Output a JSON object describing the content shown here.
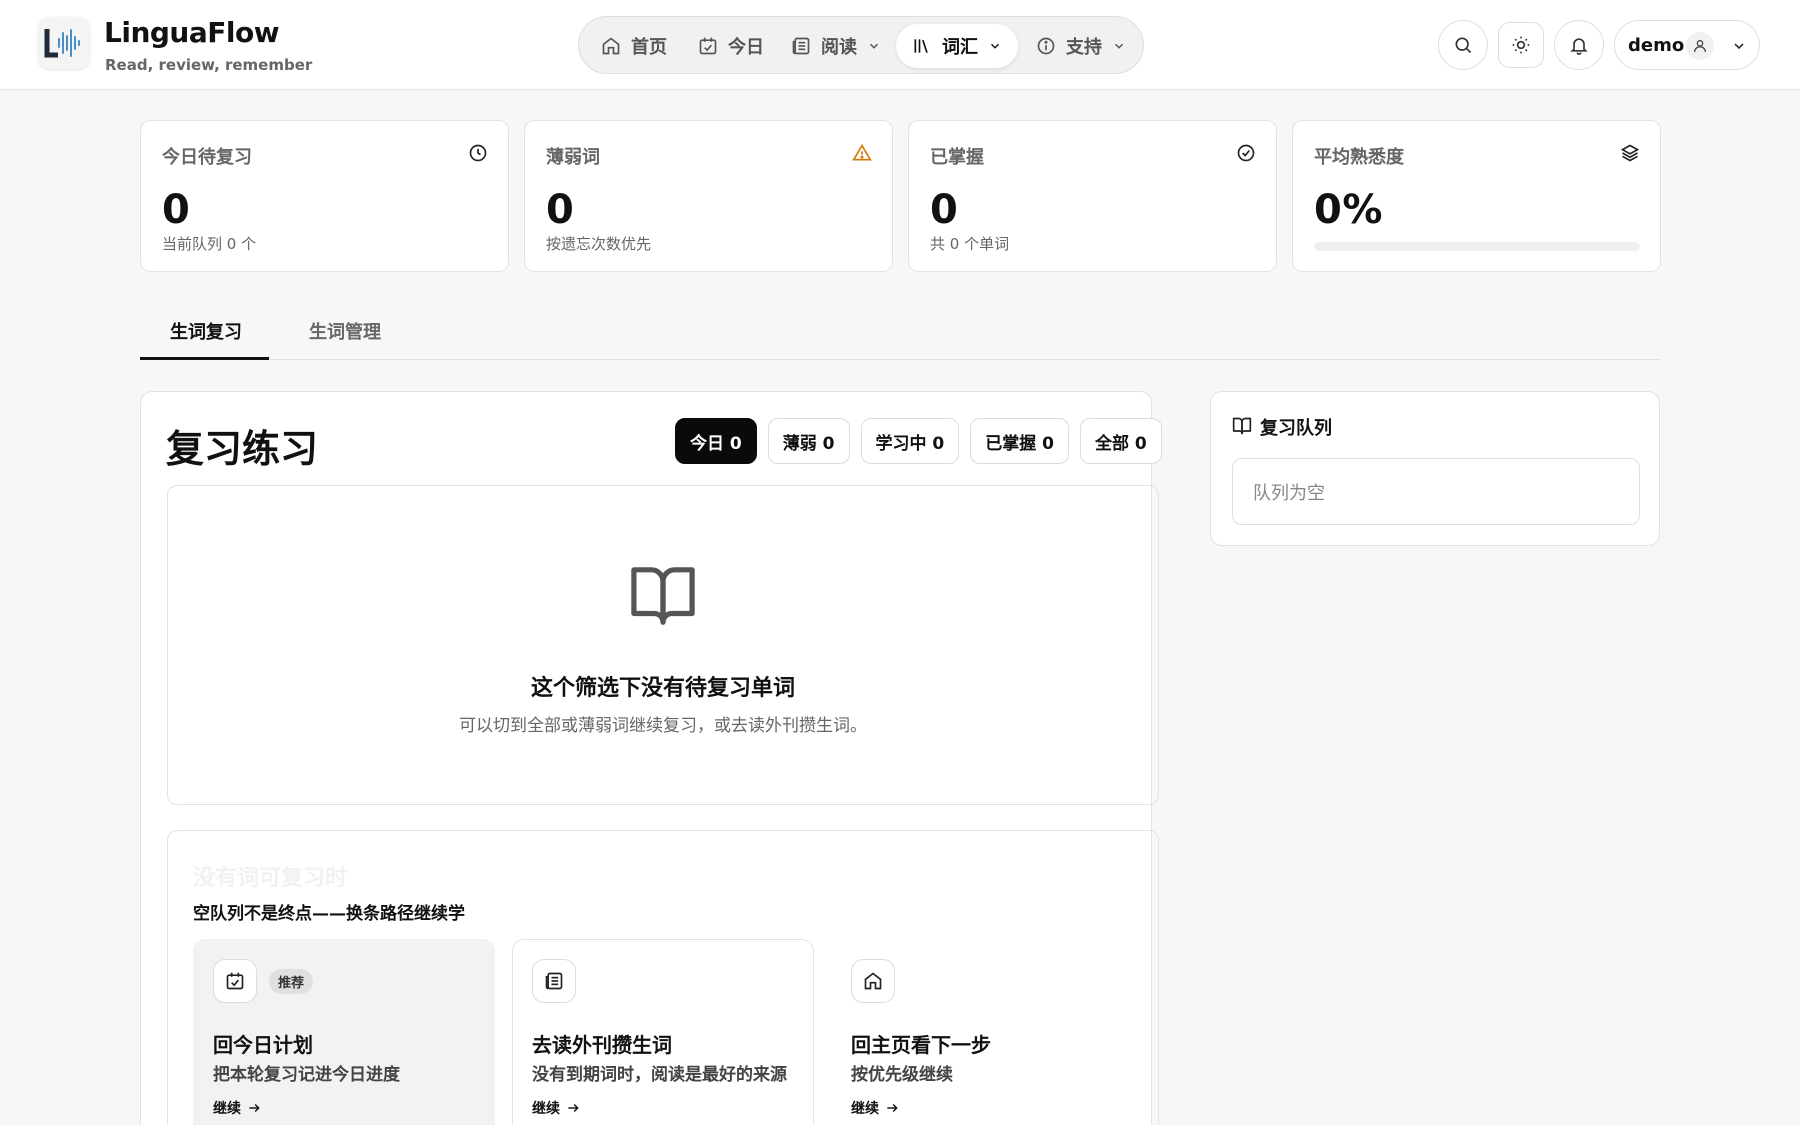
{
  "header": {
    "brand_name": "LinguaFlow",
    "brand_tagline": "Read, review, remember",
    "nav": [
      {
        "label": "首页",
        "icon": "home-icon"
      },
      {
        "label": "今日",
        "icon": "calendar-check-icon"
      },
      {
        "label": "阅读",
        "icon": "newspaper-icon",
        "dropdown": true
      },
      {
        "label": "词汇",
        "icon": "library-icon",
        "dropdown": true,
        "active": true
      },
      {
        "label": "支持",
        "icon": "info-icon",
        "dropdown": true
      }
    ],
    "user_name": "demo"
  },
  "stats": [
    {
      "title": "今日待复习",
      "value": "0",
      "note": "当前队列 0 个",
      "icon": "clock-icon"
    },
    {
      "title": "薄弱词",
      "value": "0",
      "note": "按遗忘次数优先",
      "icon": "warning-icon",
      "icon_color": "#d97706"
    },
    {
      "title": "已掌握",
      "value": "0",
      "note": "共 0 个单词",
      "icon": "check-circle-icon"
    },
    {
      "title": "平均熟悉度",
      "value": "0%",
      "progress_percent": 0,
      "icon": "layers-icon"
    }
  ],
  "tabs": [
    {
      "label": "生词复习",
      "active": true
    },
    {
      "label": "生词管理",
      "active": false
    }
  ],
  "review": {
    "title": "复习练习",
    "filters": [
      {
        "label": "今日 0",
        "active": true
      },
      {
        "label": "薄弱 0"
      },
      {
        "label": "学习中 0"
      },
      {
        "label": "已掌握 0"
      },
      {
        "label": "全部 0"
      }
    ],
    "empty_title": "这个筛选下没有待复习单词",
    "empty_subtitle": "可以切到全部或薄弱词继续复习，或去读外刊攒生词。",
    "next_ghost_title": "没有词可复习时",
    "next_subtitle": "空队列不是终点——换条路径继续学",
    "cards": [
      {
        "title": "回今日计划",
        "desc": "把本轮复习记进今日进度",
        "cta": "继续",
        "badge": "推荐",
        "icon": "calendar-check-icon"
      },
      {
        "title": "去读外刊攒生词",
        "desc": "没有到期词时，阅读是最好的来源",
        "cta": "继续",
        "icon": "newspaper-icon"
      },
      {
        "title": "回主页看下一步",
        "desc": "按优先级继续",
        "cta": "继续",
        "icon": "home-icon"
      }
    ]
  },
  "queue": {
    "title": "复习队列",
    "empty": "队列为空"
  }
}
